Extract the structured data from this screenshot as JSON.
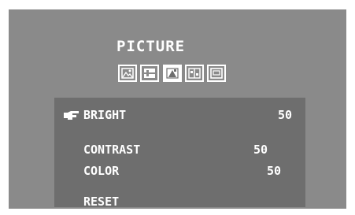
{
  "menu": {
    "title": "PICTURE",
    "tabs": [
      {
        "icon": "picture-icon",
        "active": false
      },
      {
        "icon": "image-settings-icon",
        "active": false
      },
      {
        "icon": "color-icon",
        "active": true
      },
      {
        "icon": "position-icon",
        "active": false
      },
      {
        "icon": "display-icon",
        "active": false
      }
    ],
    "items": [
      {
        "label": "BRIGHT",
        "value": "50",
        "selected": true
      },
      {
        "label": "CONTRAST",
        "value": "50",
        "selected": false
      },
      {
        "label": "COLOR",
        "value": "50",
        "selected": false
      },
      {
        "label": "RESET",
        "value": "",
        "selected": false
      }
    ]
  },
  "colors": {
    "outer_background": "#8a8a8a",
    "panel_background": "#6e6e6e",
    "text": "#ffffff"
  }
}
